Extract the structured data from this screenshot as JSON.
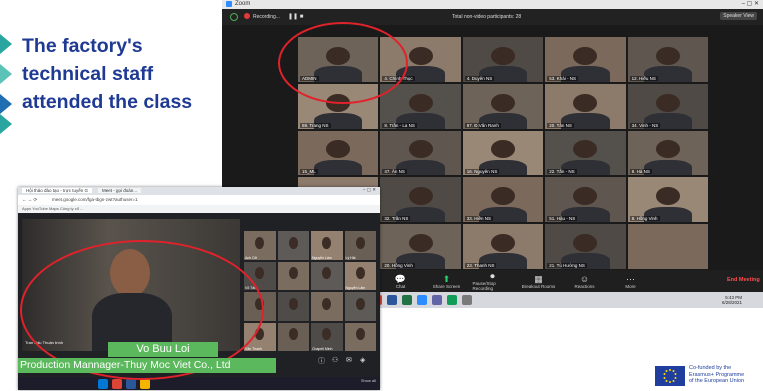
{
  "caption": {
    "line1": "The factory's",
    "line2": "technical staff",
    "line3": "attended the class"
  },
  "zoom": {
    "app_title": "Zoom",
    "recording": "Recording...",
    "participant_count": "Total non-video participants: 28",
    "speaker_view": "Speaker View",
    "tiles": [
      {
        "name": "ADMIN"
      },
      {
        "name": "4. Chính Thục"
      },
      {
        "name": "4. Duyên NS"
      },
      {
        "name": "53. Khải - NS"
      },
      {
        "name": "12. Hiếu NS"
      },
      {
        "name": "59. Trang NS"
      },
      {
        "name": "8. Trần - La NS"
      },
      {
        "name": "87. Đ.Văn Ranh"
      },
      {
        "name": "20. Tân NS"
      },
      {
        "name": "34. Vinh - NS"
      },
      {
        "name": "15_ML"
      },
      {
        "name": "47. Ân NS"
      },
      {
        "name": "16. Nguyên NS"
      },
      {
        "name": "22. Tấn - NS"
      },
      {
        "name": "8. Hà NS"
      },
      {
        "name": ""
      },
      {
        "name": "32. Trần NS"
      },
      {
        "name": "33. Hiền NS"
      },
      {
        "name": "51. Hậu - NS"
      },
      {
        "name": "8. Hồng Vinh"
      },
      {
        "name": ""
      },
      {
        "name": "20. Hồng Vinh"
      },
      {
        "name": "23. Thanh NS"
      },
      {
        "name": "21. Tú Hường NS"
      },
      {
        "name": ""
      }
    ],
    "controls": [
      {
        "label": "Manage Participants",
        "count": "35",
        "icon": "participants-icon"
      },
      {
        "label": "Chat",
        "icon": "chat-icon"
      },
      {
        "label": "Share Screen",
        "icon": "share-screen-icon"
      },
      {
        "label": "Pause/Stop Recording",
        "icon": "record-icon"
      },
      {
        "label": "Breakout Rooms",
        "icon": "breakout-icon"
      },
      {
        "label": "Reactions",
        "icon": "reactions-icon"
      },
      {
        "label": "More",
        "icon": "more-icon"
      }
    ],
    "end_label": "End Meeting",
    "clock_time": "5:43 PM",
    "clock_date": "6/28/2021"
  },
  "meet": {
    "tab1": "Hội thảo đào tạo - trực tuyến G",
    "tab2": "Meet - gọi đoán...",
    "url": "meet.google.com/fga-tbgn-zwt?authuser=1",
    "bookmarks": "Apps  YouTube  Maps  Công ty cổ ...",
    "rec_badge": "REC",
    "main_name": "Tran Dấu Thuận trình",
    "side_names": [
      "Anh Dỡ",
      "",
      "Nguyễn Lâm",
      "Lý Hải",
      "Võ Tâm",
      "",
      "",
      "Nguyễn Lâm",
      "",
      "",
      "",
      "",
      "Văn Thanh",
      "",
      "Chapell Minh",
      ""
    ],
    "lower_third_name": "Vo Buu Loi",
    "lower_third_title": "Production Mannager-Thuy Moc Viet Co., Ltd",
    "show_all": "Show all"
  },
  "eu": {
    "line1": "Co-funded by the",
    "line2": "Erasmus+ Programme",
    "line3": "of the European Union"
  },
  "colors": {
    "caption_blue": "#1f3a93",
    "highlight_red": "#e0222b",
    "lower_third_green": "#5cb85c"
  }
}
